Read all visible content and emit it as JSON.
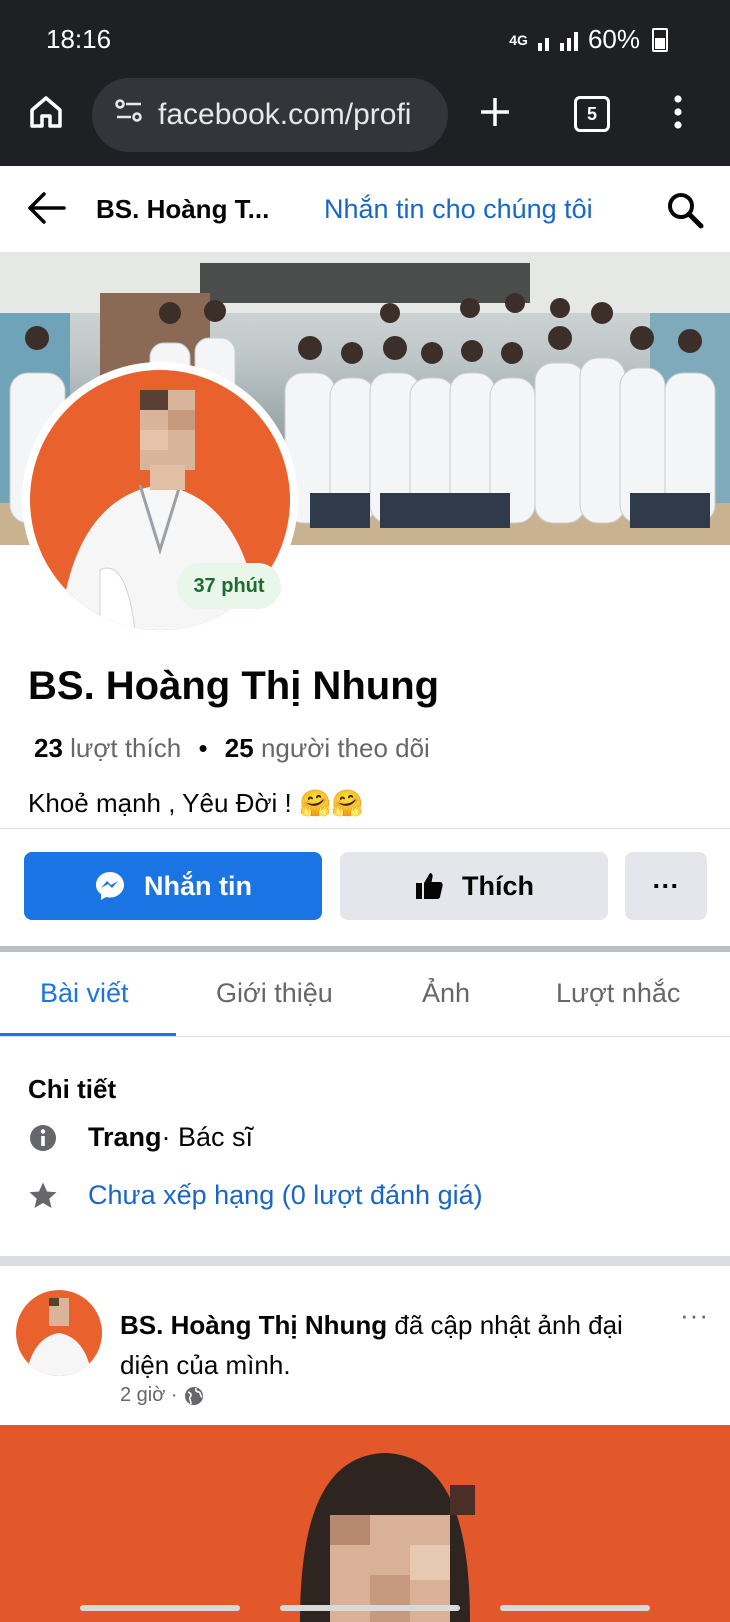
{
  "status_bar": {
    "time": "18:16",
    "network": "4G",
    "battery": "60%"
  },
  "browser": {
    "url": "facebook.com/profi",
    "tab_count": "5"
  },
  "page_header": {
    "title": "BS. Hoàng T...",
    "message_link": "Nhắn tin cho chúng tôi"
  },
  "profile": {
    "status_badge": "37 phút",
    "name": "BS. Hoàng Thị Nhung",
    "likes_count": "23",
    "likes_label": "lượt thích",
    "followers_count": "25",
    "followers_label": "người theo dõi",
    "bio": "Khoẻ mạnh , Yêu Đời ! 🤗🤗"
  },
  "actions": {
    "message": "Nhắn tin",
    "like": "Thích",
    "more": "···"
  },
  "tabs": [
    "Bài viết",
    "Giới thiệu",
    "Ảnh",
    "Lượt nhắc"
  ],
  "details": {
    "title": "Chi tiết",
    "category_label": "Trang",
    "category_value": " · Bác sĩ",
    "rating": "Chưa xếp hạng (0 lượt đánh giá)"
  },
  "post": {
    "author": "BS. Hoàng Thị Nhung",
    "action": " đã cập nhật ảnh đại diện của mình.",
    "time": "2 giờ ·",
    "more": "···"
  },
  "colors": {
    "facebook_blue": "#1b74e4",
    "avatar_orange": "#e9622d",
    "link_blue": "#1866c7"
  }
}
